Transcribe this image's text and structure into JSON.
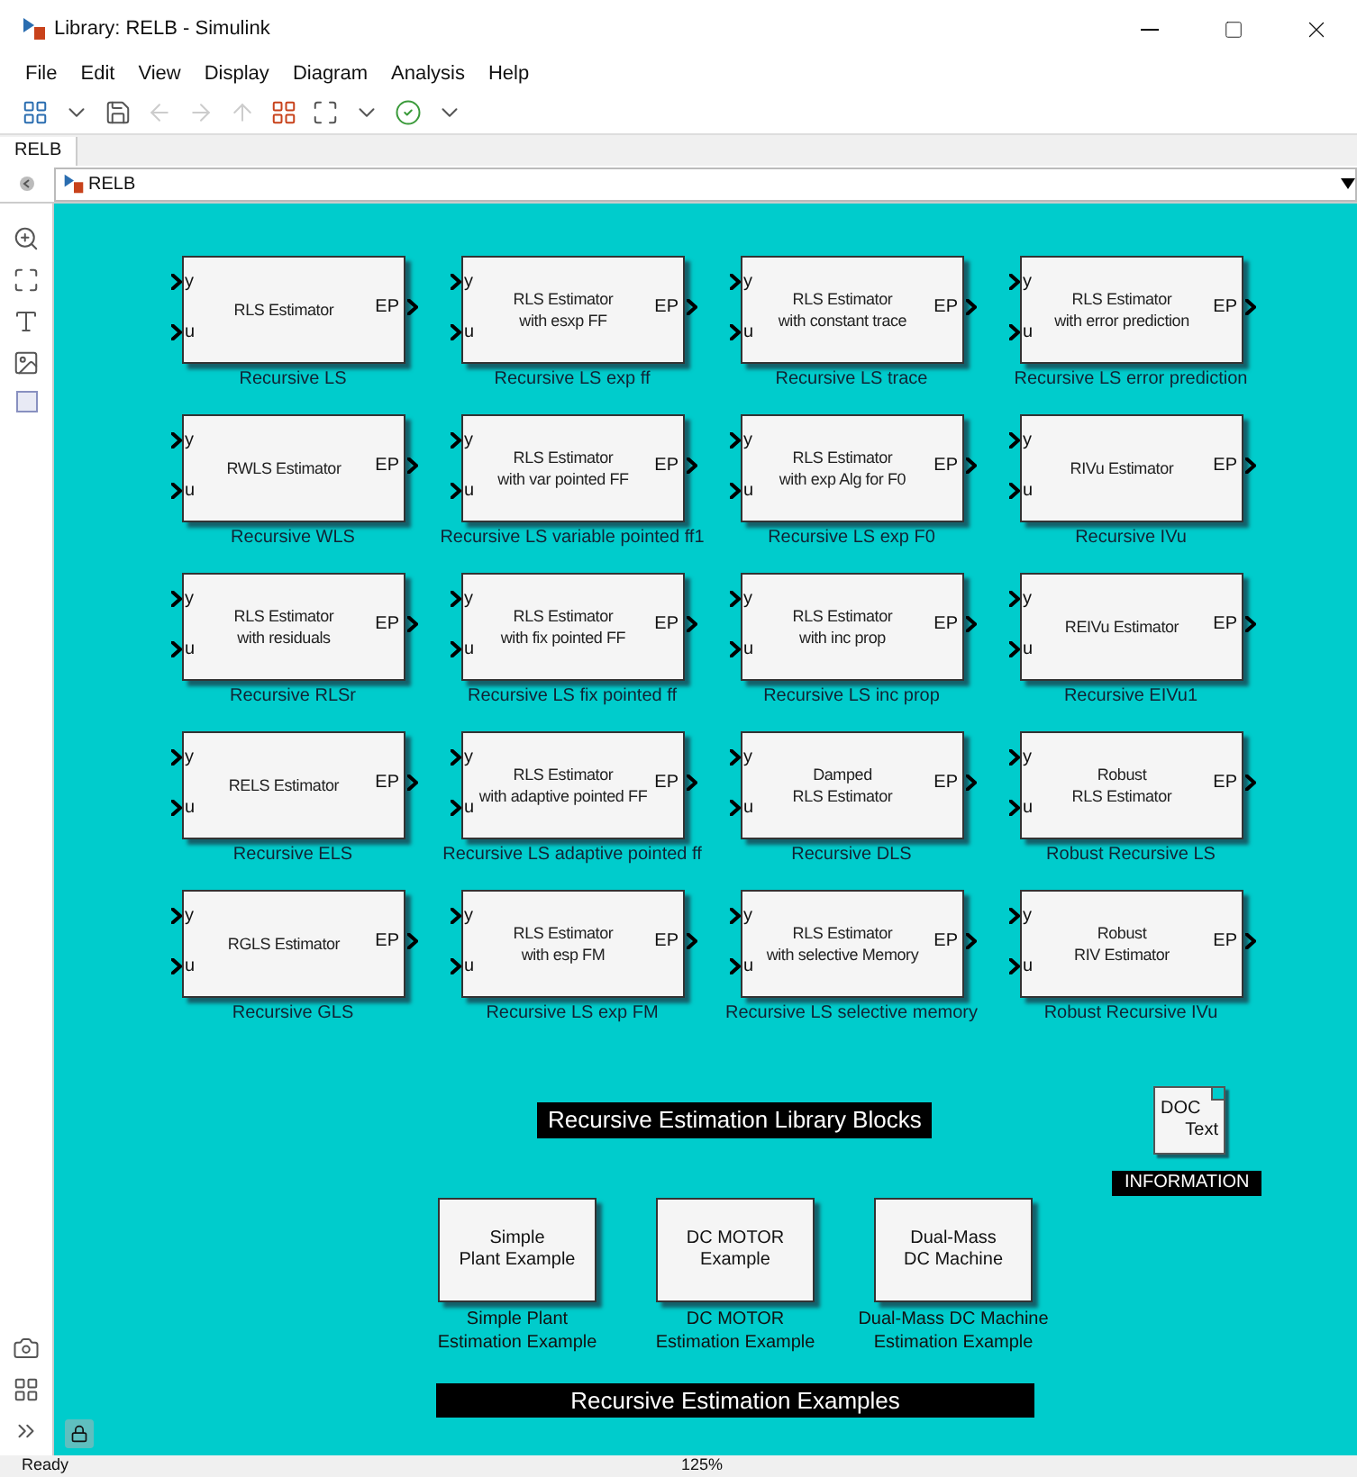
{
  "window": {
    "title": "Library: RELB - Simulink"
  },
  "menu": [
    "File",
    "Edit",
    "View",
    "Display",
    "Diagram",
    "Analysis",
    "Help"
  ],
  "tabs": [
    {
      "label": "RELB",
      "selected": true
    }
  ],
  "address": {
    "path": "RELB"
  },
  "blocks": [
    {
      "lines": [
        "RLS Estimator"
      ],
      "inputs": [
        "y",
        "u"
      ],
      "output": "EP",
      "caption": "Recursive LS"
    },
    {
      "lines": [
        "RLS Estimator",
        "with esxp FF"
      ],
      "inputs": [
        "y",
        "u"
      ],
      "output": "EP",
      "caption": "Recursive LS exp ff"
    },
    {
      "lines": [
        "RLS Estimator",
        "with constant trace"
      ],
      "inputs": [
        "y",
        "u"
      ],
      "output": "EP",
      "caption": "Recursive LS trace"
    },
    {
      "lines": [
        "RLS Estimator",
        "with error prediction"
      ],
      "inputs": [
        "y",
        "u"
      ],
      "output": "EP",
      "caption": "Recursive LS error prediction"
    },
    {
      "lines": [
        "RWLS Estimator"
      ],
      "inputs": [
        "y",
        "u"
      ],
      "output": "EP",
      "caption": "Recursive WLS"
    },
    {
      "lines": [
        "RLS Estimator",
        "with var pointed FF"
      ],
      "inputs": [
        "y",
        "u"
      ],
      "output": "EP",
      "caption": "Recursive LS variable pointed ff1"
    },
    {
      "lines": [
        "RLS Estimator",
        "with exp Alg for F0"
      ],
      "inputs": [
        "y",
        "u"
      ],
      "output": "EP",
      "caption": "Recursive LS exp F0"
    },
    {
      "lines": [
        "RIVu Estimator"
      ],
      "inputs": [
        "y",
        "u"
      ],
      "output": "EP",
      "caption": "Recursive IVu"
    },
    {
      "lines": [
        "RLS Estimator",
        "with residuals"
      ],
      "inputs": [
        "y",
        "u"
      ],
      "output": "EP",
      "caption": "Recursive RLSr"
    },
    {
      "lines": [
        "RLS Estimator",
        "with fix pointed FF"
      ],
      "inputs": [
        "y",
        "u"
      ],
      "output": "EP",
      "caption": "Recursive LS fix pointed ff"
    },
    {
      "lines": [
        "RLS Estimator",
        "with inc prop"
      ],
      "inputs": [
        "y",
        "u"
      ],
      "output": "EP",
      "caption": "Recursive LS inc prop"
    },
    {
      "lines": [
        "REIVu Estimator"
      ],
      "inputs": [
        "y",
        "u"
      ],
      "output": "EP",
      "caption": "Recursive EIVu1"
    },
    {
      "lines": [
        "RELS Estimator"
      ],
      "inputs": [
        "y",
        "u"
      ],
      "output": "EP",
      "caption": "Recursive ELS"
    },
    {
      "lines": [
        "RLS Estimator",
        "with adaptive pointed FF"
      ],
      "inputs": [
        "y",
        "u"
      ],
      "output": "EP",
      "caption": "Recursive LS adaptive pointed ff"
    },
    {
      "lines": [
        "Damped",
        "RLS Estimator"
      ],
      "inputs": [
        "y",
        "u"
      ],
      "output": "EP",
      "caption": "Recursive DLS"
    },
    {
      "lines": [
        "Robust",
        "RLS Estimator"
      ],
      "inputs": [
        "y",
        "u"
      ],
      "output": "EP",
      "caption": "Robust Recursive LS"
    },
    {
      "lines": [
        "RGLS Estimator"
      ],
      "inputs": [
        "y",
        "u"
      ],
      "output": "EP",
      "caption": "Recursive GLS"
    },
    {
      "lines": [
        "RLS Estimator",
        "with esp FM"
      ],
      "inputs": [
        "y",
        "u"
      ],
      "output": "EP",
      "caption": "Recursive LS exp FM"
    },
    {
      "lines": [
        "RLS Estimator",
        "with selective Memory"
      ],
      "inputs": [
        "y",
        "u"
      ],
      "output": "EP",
      "caption": "Recursive LS selective memory"
    },
    {
      "lines": [
        "Robust",
        "RIV Estimator"
      ],
      "inputs": [
        "y",
        "u"
      ],
      "output": "EP",
      "caption": "Robust Recursive IVu"
    }
  ],
  "library_banner": "Recursive Estimation Library Blocks",
  "doc_block": {
    "lines": [
      "DOC",
      "Text"
    ],
    "caption": "INFORMATION"
  },
  "examples": [
    {
      "lines": [
        "Simple",
        "Plant Example"
      ],
      "caption": [
        "Simple Plant",
        "Estimation Example"
      ]
    },
    {
      "lines": [
        "DC MOTOR",
        "Example"
      ],
      "caption": [
        "DC MOTOR",
        "Estimation Example"
      ]
    },
    {
      "lines": [
        "Dual-Mass",
        "DC Machine"
      ],
      "caption": [
        "Dual-Mass DC Machine",
        "Estimation Example"
      ]
    }
  ],
  "examples_banner": "Recursive Estimation Examples",
  "status_bar": {
    "state": "Ready",
    "zoom": "125%"
  }
}
